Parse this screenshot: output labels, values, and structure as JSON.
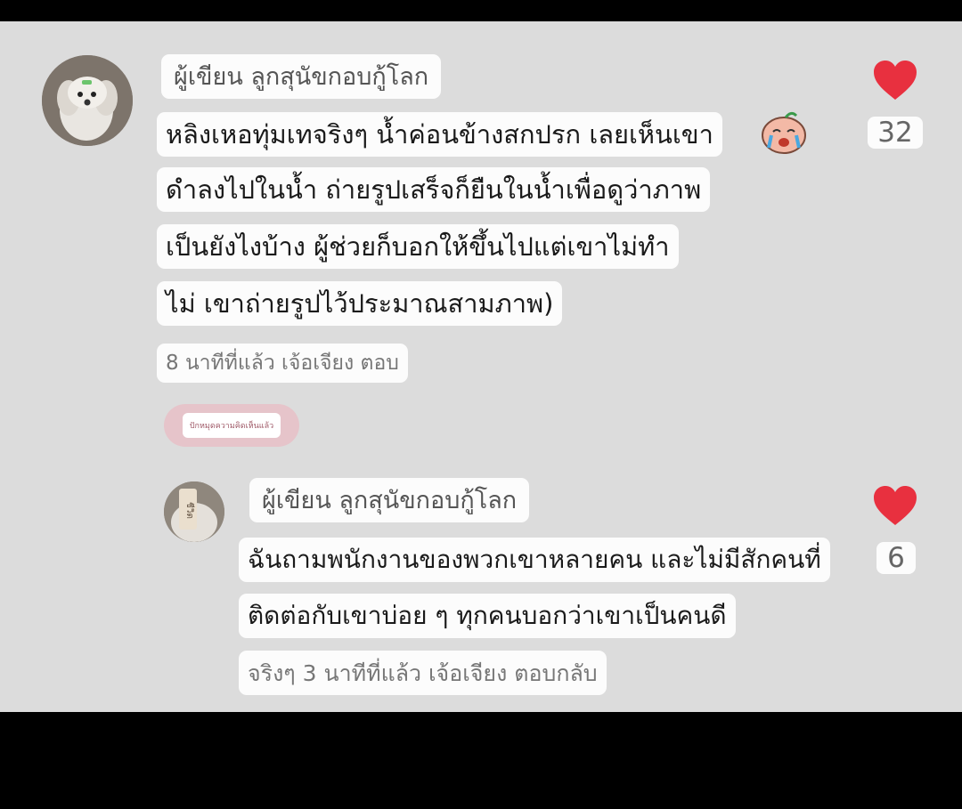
{
  "comment": {
    "author": "ผู้เขียน ลูกสุนัขกอบกู้โลก",
    "lines": [
      "หลิงเหอทุ่มเทจริงๆ น้ำค่อนข้างสกปรก เลยเห็นเขา",
      "ดำลงไปในน้ำ ถ่ายรูปเสร็จก็ยืนในน้ำเพื่อดูว่าภาพ",
      "เป็นยังไงบ้าง ผู้ช่วยก็บอกให้ขึ้นไปแต่เขาไม่ทำ",
      "ไม่ เขาถ่ายรูปไว้ประมาณสามภาพ)"
    ],
    "meta": "8 นาทีที่แล้ว เจ้อเจียง ตอบ",
    "likes": "32",
    "avatar_icon": "dog-avatar-icon",
    "sticker_icon": "crying-face-sticker-icon"
  },
  "tag": {
    "label": "ปักหมุดความคิดเห็นแล้ว"
  },
  "reply": {
    "author": "ผู้เขียน ลูกสุนัขกอบกู้โลก",
    "lines": [
      "ฉันถามพนักงานของพวกเขาหลายคน และไม่มีสักคนที่",
      "ติดต่อกับเขาบ่อย ๆ ทุกคนบอกว่าเขาเป็นคนดี"
    ],
    "meta": "จริงๆ 3 นาทีที่แล้ว เจ้อเจียง ตอบกลับ",
    "likes": "6",
    "avatar_text": "ชีวิต",
    "avatar_icon": "dog-avatar-icon"
  },
  "colors": {
    "heart": "#e8303f",
    "panel": "#dcdcdc",
    "tag_bg": "#e6c4ca"
  }
}
